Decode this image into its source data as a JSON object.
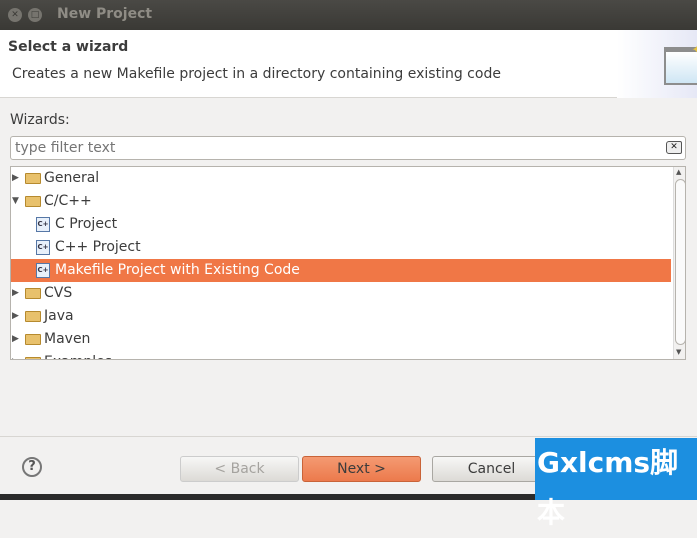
{
  "window": {
    "title": "New Project"
  },
  "header": {
    "title": "Select a wizard",
    "description": "Creates a new Makefile project in a directory containing existing code"
  },
  "wizards_label": "Wizards:",
  "filter": {
    "placeholder": "type filter text",
    "value": ""
  },
  "tree": [
    {
      "label": "General",
      "type": "folder",
      "expanded": false,
      "level": 0
    },
    {
      "label": "C/C++",
      "type": "folder",
      "expanded": true,
      "level": 0
    },
    {
      "label": "C Project",
      "type": "file",
      "level": 1
    },
    {
      "label": "C++ Project",
      "type": "file",
      "level": 1
    },
    {
      "label": "Makefile Project with Existing Code",
      "type": "file",
      "level": 1,
      "selected": true
    },
    {
      "label": "CVS",
      "type": "folder",
      "expanded": false,
      "level": 0
    },
    {
      "label": "Java",
      "type": "folder",
      "expanded": false,
      "level": 0
    },
    {
      "label": "Maven",
      "type": "folder",
      "expanded": false,
      "level": 0
    },
    {
      "label": "Examples",
      "type": "folder",
      "expanded": false,
      "level": 0
    }
  ],
  "buttons": {
    "back": "< Back",
    "next": "Next >",
    "cancel": "Cancel",
    "help": "?"
  },
  "watermark": "Gxlcms脚本",
  "colors": {
    "selection": "#f07746",
    "watermark": "#1c8fe0"
  }
}
